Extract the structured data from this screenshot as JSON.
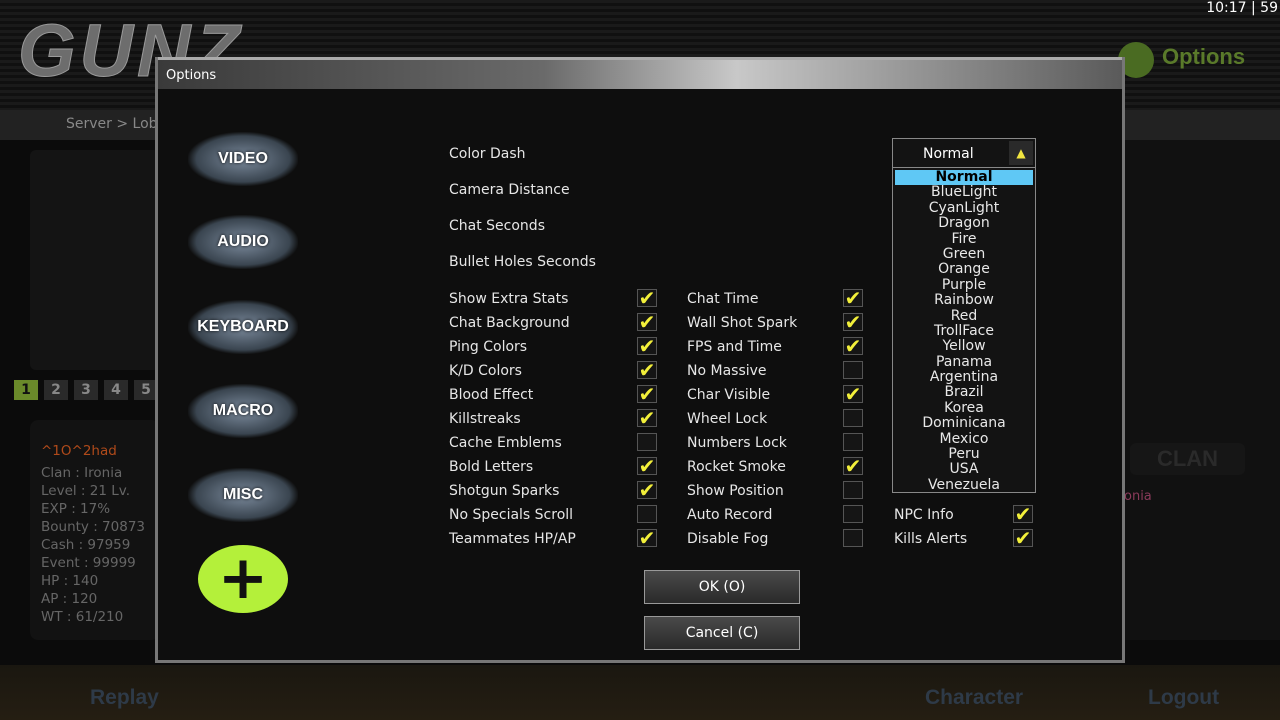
{
  "background": {
    "logo": "GUNZ",
    "clock": "10:17 | 59",
    "options_label": "Options",
    "breadcrumb": "Server > Lob",
    "pages": [
      "1",
      "2",
      "3",
      "4",
      "5"
    ],
    "player": {
      "name": "^1O^2had",
      "lines": [
        "Clan : Ironia",
        "Level : 21 Lv.",
        "EXP : 17%",
        "Bounty : 70873",
        "Cash : 97959",
        "Event : 99999",
        "HP : 140",
        "AP : 120",
        "WT : 61/210"
      ]
    },
    "clan_tab": "CLAN",
    "clan_member": "onia",
    "bottom": {
      "replay": "Replay",
      "character": "Character",
      "logout": "Logout"
    }
  },
  "dialog": {
    "title": "Options",
    "categories": [
      "VIDEO",
      "AUDIO",
      "KEYBOARD",
      "MACRO",
      "MISC"
    ],
    "add_icon": "plus-icon",
    "settings": [
      "Color Dash",
      "Camera Distance",
      "Chat Seconds",
      "Bullet Holes Seconds"
    ],
    "color_dash": {
      "selected": "Normal",
      "options": [
        "Normal",
        "BlueLight",
        "CyanLight",
        "Dragon",
        "Fire",
        "Green",
        "Orange",
        "Purple",
        "Rainbow",
        "Red",
        "TrollFace",
        "Yellow",
        "Panama",
        "Argentina",
        "Brazil",
        "Korea",
        "Dominicana",
        "Mexico",
        "Peru",
        "USA",
        "Venezuela"
      ]
    },
    "check_col1": [
      {
        "label": "Show Extra Stats",
        "checked": true
      },
      {
        "label": "Chat Background",
        "checked": true
      },
      {
        "label": "Ping Colors",
        "checked": true
      },
      {
        "label": "K/D Colors",
        "checked": true
      },
      {
        "label": "Blood Effect",
        "checked": true
      },
      {
        "label": "Killstreaks",
        "checked": true
      },
      {
        "label": "Cache Emblems",
        "checked": false
      },
      {
        "label": "Bold Letters",
        "checked": true
      },
      {
        "label": "Shotgun Sparks",
        "checked": true
      },
      {
        "label": "No Specials Scroll",
        "checked": false
      },
      {
        "label": "Teammates HP/AP",
        "checked": true
      }
    ],
    "check_col2": [
      {
        "label": "Chat Time",
        "checked": true
      },
      {
        "label": "Wall Shot Spark",
        "checked": true
      },
      {
        "label": "FPS and Time",
        "checked": true
      },
      {
        "label": "No Massive",
        "checked": false
      },
      {
        "label": "Char Visible",
        "checked": true
      },
      {
        "label": "Wheel Lock",
        "checked": false
      },
      {
        "label": "Numbers Lock",
        "checked": false
      },
      {
        "label": "Rocket Smoke",
        "checked": true
      },
      {
        "label": "Show Position",
        "checked": false
      },
      {
        "label": "Auto Record",
        "checked": false
      },
      {
        "label": "Disable Fog",
        "checked": false
      }
    ],
    "check_col3": [
      {
        "label": "NPC Info",
        "checked": true
      },
      {
        "label": "Kills Alerts",
        "checked": true
      }
    ],
    "ok": "OK (O)",
    "cancel": "Cancel (C)",
    "check_color": "#f2ef3a",
    "highlight_color": "#5fc8f5"
  }
}
